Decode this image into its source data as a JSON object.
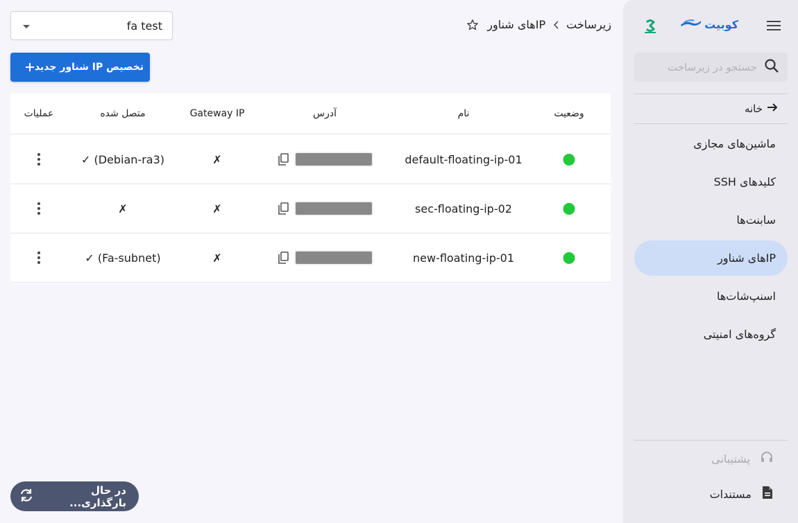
{
  "sidebar": {
    "brand_name": "کوبیت",
    "brand_color": "#1e6fd9",
    "search_placeholder": "جستجو در زیرساخت",
    "home_label": "خانه",
    "items": [
      {
        "label": "ماشین‌های مجازی",
        "active": false
      },
      {
        "label": "کلیدهای SSH",
        "active": false
      },
      {
        "label": "سابنت‌ها",
        "active": false
      },
      {
        "label": "IPهای شناور",
        "active": true
      },
      {
        "label": "اسنپ‌شات‌ها",
        "active": false
      },
      {
        "label": "گروه‌های امنیتی",
        "active": false
      }
    ],
    "support_label": "پشتیبانی",
    "docs_label": "مستندات"
  },
  "header": {
    "breadcrumb": [
      "زیرساخت",
      "IPهای شناور"
    ],
    "project": "fa test",
    "new_button_label": "تخصیص IP شناور جدید"
  },
  "table": {
    "columns": {
      "status": "وضعیت",
      "name": "نام",
      "address": "آدرس",
      "gateway": "Gateway IP",
      "connected": "متصل شده",
      "ops": "عملیات"
    },
    "rows": [
      {
        "status": "active",
        "name": "default-floating-ip-01",
        "address": "redacted",
        "gateway": "✗",
        "connected": "✓ (Debian-ra3)"
      },
      {
        "status": "active",
        "name": "sec-floating-ip-02",
        "address": "redacted",
        "gateway": "✗",
        "connected": "✗"
      },
      {
        "status": "active",
        "name": "new-floating-ip-01",
        "address": "redacted",
        "gateway": "✗",
        "connected": "✓ (Fa-subnet)"
      }
    ]
  },
  "loading_label": "در حال بارگذاری...",
  "colors": {
    "accent": "#1f6fd8",
    "status_active": "#22c93a",
    "active_nav": "#cdddf8"
  }
}
